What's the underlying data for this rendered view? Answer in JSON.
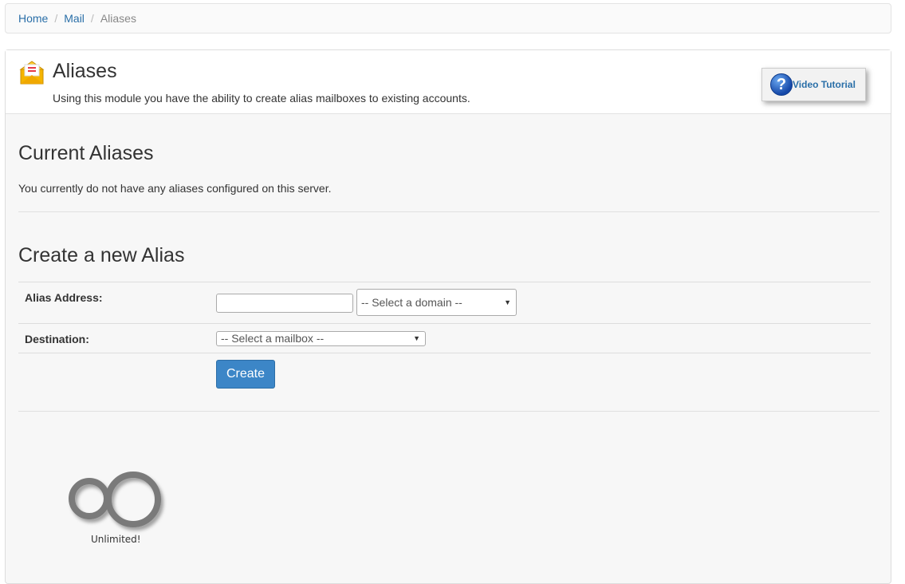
{
  "breadcrumb": {
    "home": "Home",
    "mail": "Mail",
    "current": "Aliases",
    "separator": "/"
  },
  "header": {
    "title": "Aliases",
    "description": "Using this module you have the ability to create alias mailboxes to existing accounts.",
    "video_tutorial": "Video Tutorial",
    "video_icon_glyph": "?"
  },
  "current": {
    "heading": "Current Aliases",
    "message": "You currently do not have any aliases configured on this server."
  },
  "create": {
    "heading": "Create a new Alias",
    "alias_label": "Alias Address:",
    "alias_value": "",
    "domain_select": "-- Select a domain --",
    "destination_label": "Destination:",
    "mailbox_select": "-- Select a mailbox --",
    "create_button": "Create"
  },
  "quota": {
    "label": "Unlimited!"
  },
  "icons": {
    "module": "envelope-icon",
    "video": "help-icon",
    "dropdown": "caret-down-icon",
    "unlimited": "infinity-icon"
  },
  "colors": {
    "link": "#2a6fa8",
    "primary_button": "#3c86c7",
    "panel_bg": "#f7f7f7"
  }
}
